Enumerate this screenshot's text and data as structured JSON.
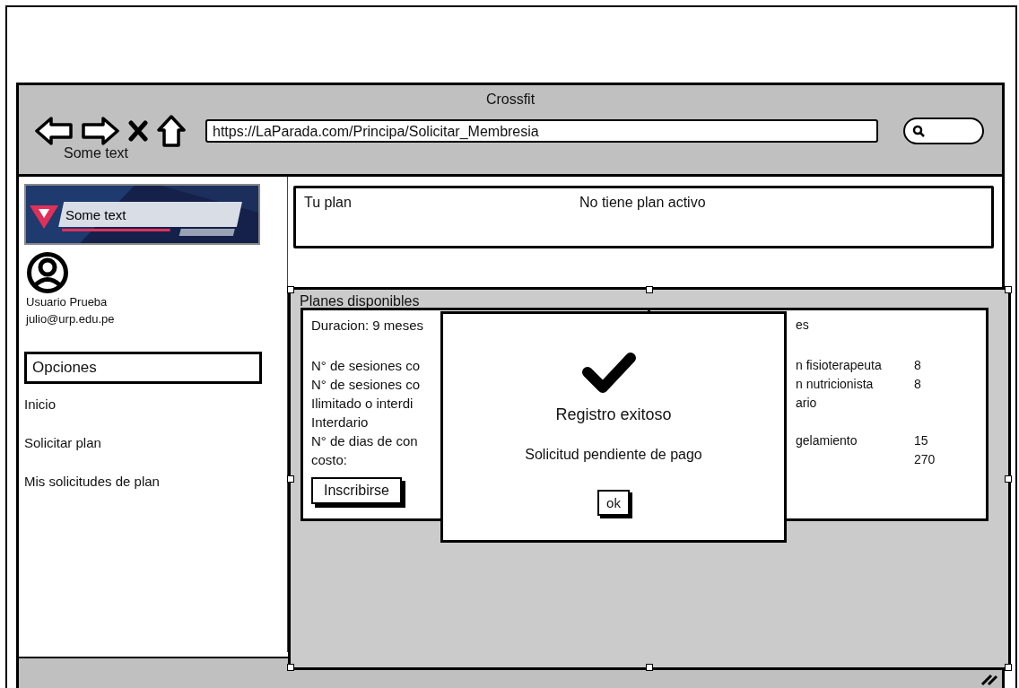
{
  "window": {
    "title": "Crossfit",
    "nav_caption": "Some text",
    "url": "https://LaParada.com/Principa/Solicitar_Membresia"
  },
  "sidebar": {
    "logo": {
      "kind": "picture",
      "caption": "Some text"
    },
    "user": {
      "name": "Usuario Prueba",
      "email": "julio@urp.edu.pe"
    },
    "menu_title": "Opciones",
    "items": [
      "Inicio",
      "Solicitar plan",
      "Mis solicitudes de plan"
    ]
  },
  "plan": {
    "label": "Tu plan",
    "value": "No tiene plan activo"
  },
  "plans_panel": {
    "title": "Planes disponibles",
    "cards": [
      {
        "rows": [
          {
            "kind": "text",
            "label": "Duracion: 9 meses"
          },
          {
            "kind": "gap"
          },
          {
            "kind": "text",
            "label": "N° de sesiones co"
          },
          {
            "kind": "text",
            "label": "N° de sesiones co"
          },
          {
            "kind": "text",
            "label": "Ilimitado o interdi"
          },
          {
            "kind": "text",
            "label": "Interdario"
          },
          {
            "kind": "text",
            "label": "N° de dias de con"
          },
          {
            "kind": "text",
            "label": "costo:"
          }
        ],
        "button": "Inscribirse"
      },
      {
        "rows": [
          {
            "kind": "text",
            "label": "es"
          },
          {
            "kind": "gap"
          },
          {
            "kind": "text",
            "label": "n fisioterapeuta",
            "value": "8"
          },
          {
            "kind": "text",
            "label": "n nutricionista",
            "value": "8"
          },
          {
            "kind": "text",
            "label": "ario"
          },
          {
            "kind": "gap"
          },
          {
            "kind": "text",
            "label": "gelamiento",
            "value": "15"
          },
          {
            "kind": "text",
            "value": "270"
          }
        ]
      }
    ]
  },
  "dialog": {
    "title": "Registro exitoso",
    "message": "Solicitud pendiente de pago",
    "button": "ok"
  }
}
